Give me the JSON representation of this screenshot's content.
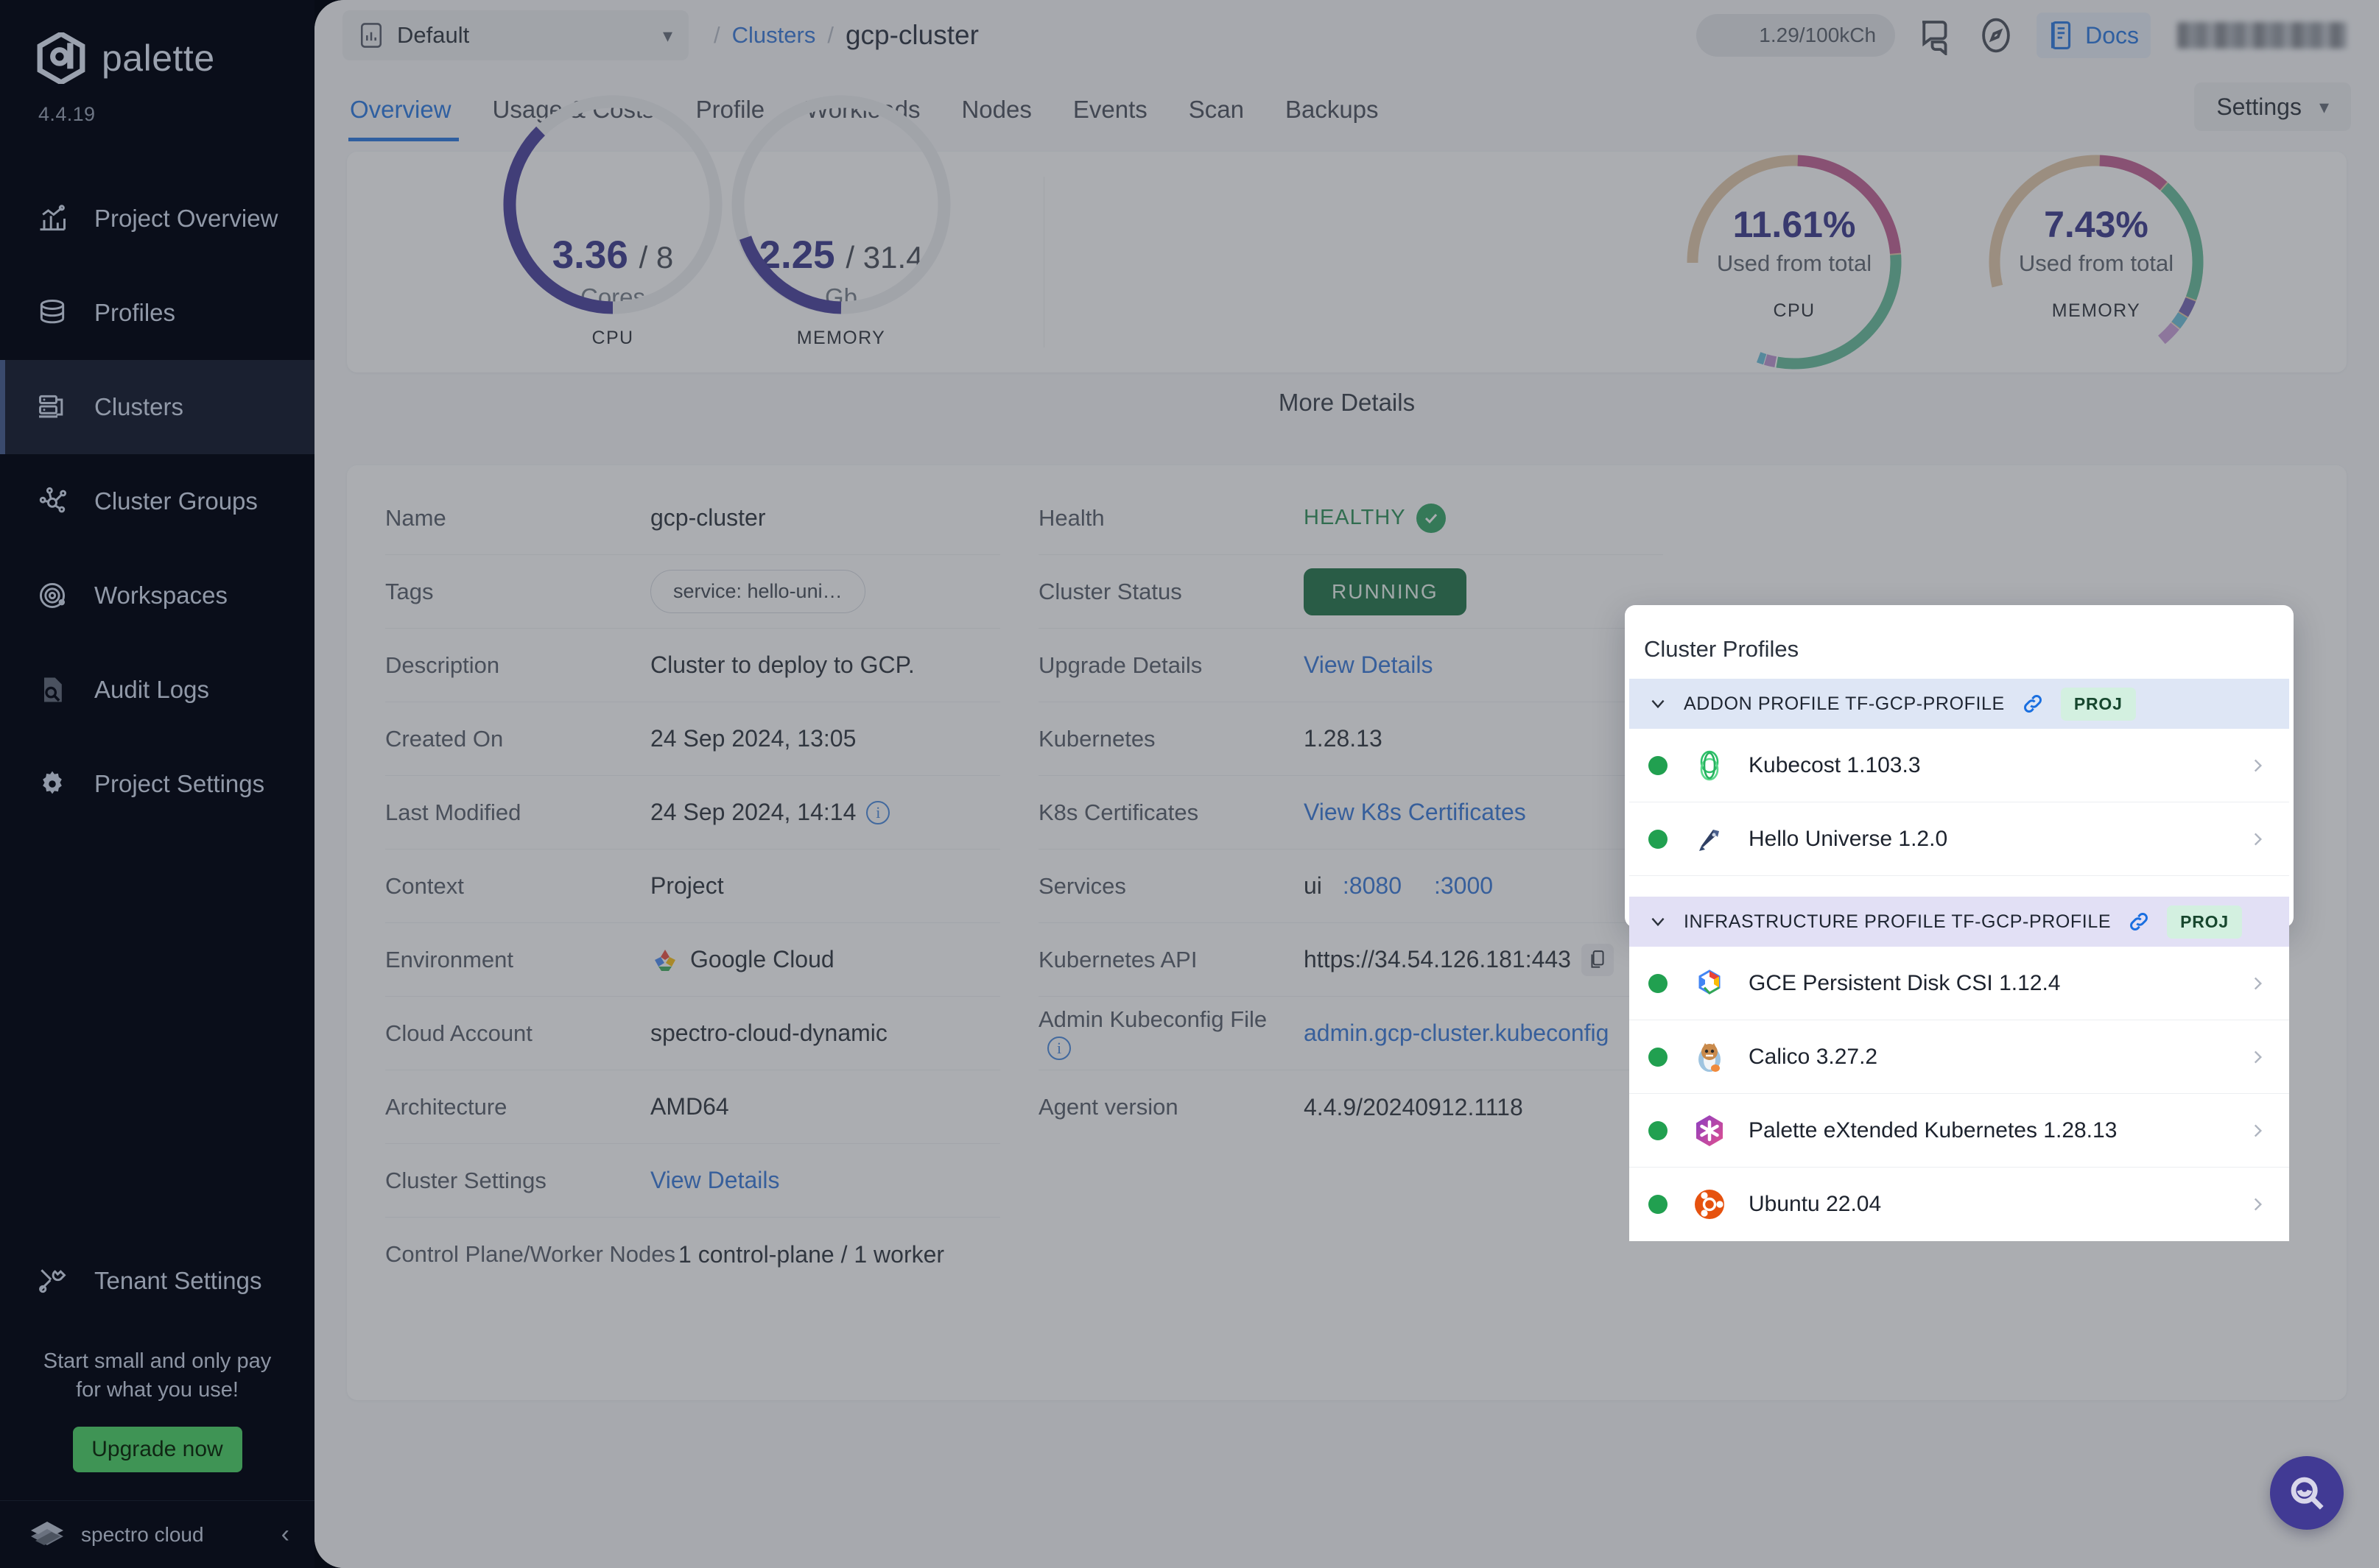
{
  "sidebar": {
    "brand": "palette",
    "version": "4.4.19",
    "items": [
      {
        "label": "Project Overview",
        "icon": "chart-bars-icon"
      },
      {
        "label": "Profiles",
        "icon": "layers-icon"
      },
      {
        "label": "Clusters",
        "icon": "servers-icon"
      },
      {
        "label": "Cluster Groups",
        "icon": "nodes-icon"
      },
      {
        "label": "Workspaces",
        "icon": "orbit-icon"
      },
      {
        "label": "Audit Logs",
        "icon": "document-search-icon"
      },
      {
        "label": "Project Settings",
        "icon": "gear-icon"
      }
    ],
    "tenant_settings": "Tenant Settings",
    "promo_line1": "Start small and only pay",
    "promo_line2": "for what you use!",
    "upgrade_label": "Upgrade now",
    "footer_brand": "spectro cloud"
  },
  "topbar": {
    "project": "Default",
    "breadcrumb_parent": "Clusters",
    "breadcrumb_current": "gcp-cluster",
    "usage_chip": "1.29/100kCh",
    "docs_label": "Docs"
  },
  "tabs": [
    {
      "label": "Overview",
      "active": true
    },
    {
      "label": "Usage & Costs",
      "active": false
    },
    {
      "label": "Profile",
      "active": false
    },
    {
      "label": "Workloads",
      "active": false
    },
    {
      "label": "Nodes",
      "active": false
    },
    {
      "label": "Events",
      "active": false
    },
    {
      "label": "Scan",
      "active": false
    },
    {
      "label": "Backups",
      "active": false
    }
  ],
  "settings_button": "Settings",
  "metrics": {
    "gauges": [
      {
        "value": "3.36",
        "total": "/ 8",
        "unit": "Cores",
        "caption": "CPU",
        "pct": 42
      },
      {
        "value": "2.25",
        "total": "/ 31.4",
        "unit": "Gb",
        "caption": "MEMORY",
        "pct": 7.2
      }
    ],
    "donuts": [
      {
        "pct": "11.61%",
        "sub": "Used from total",
        "caption": "CPU"
      },
      {
        "pct": "7.43%",
        "sub": "Used from total",
        "caption": "MEMORY"
      }
    ],
    "more_details": "More Details"
  },
  "details_left": [
    {
      "label": "Name",
      "value": "gcp-cluster",
      "kind": "text"
    },
    {
      "label": "Tags",
      "value": "service: hello-uni…",
      "kind": "tag"
    },
    {
      "label": "Description",
      "value": "Cluster to deploy to GCP.",
      "kind": "text"
    },
    {
      "label": "Created On",
      "value": "24 Sep 2024, 13:05",
      "kind": "text"
    },
    {
      "label": "Last Modified",
      "value": "24 Sep 2024, 14:14",
      "kind": "text-info"
    },
    {
      "label": "Context",
      "value": "Project",
      "kind": "text"
    },
    {
      "label": "Environment",
      "value": "Google Cloud",
      "kind": "env"
    },
    {
      "label": "Cloud Account",
      "value": "spectro-cloud-dynamic",
      "kind": "text"
    },
    {
      "label": "Architecture",
      "value": "AMD64",
      "kind": "text"
    },
    {
      "label": "Cluster Settings",
      "value": "View Details",
      "kind": "link"
    },
    {
      "label": "Control Plane/Worker Nodes",
      "value": "1 control-plane / 1 worker",
      "kind": "text"
    }
  ],
  "details_right": [
    {
      "label": "Health",
      "value": "HEALTHY",
      "kind": "health"
    },
    {
      "label": "Cluster Status",
      "value": "RUNNING",
      "kind": "pill"
    },
    {
      "label": "Upgrade Details",
      "value": "View Details",
      "kind": "link"
    },
    {
      "label": "Kubernetes",
      "value": "1.28.13",
      "kind": "text"
    },
    {
      "label": "K8s Certificates",
      "value": "View K8s Certificates",
      "kind": "link"
    },
    {
      "label": "Services",
      "value": "ui",
      "ports": [
        ":8080",
        ":3000"
      ],
      "kind": "services"
    },
    {
      "label": "Kubernetes API",
      "value": "https://34.54.126.181:443",
      "kind": "copy"
    },
    {
      "label": "Admin Kubeconfig File",
      "value": "admin.gcp-cluster.kubeconfig",
      "kind": "link-info"
    },
    {
      "label": "Agent version",
      "value": "4.4.9/20240912.1118",
      "kind": "text"
    }
  ],
  "popup": {
    "title": "Cluster Profiles",
    "groups": [
      {
        "label": "ADDON PROFILE TF-GCP-PROFILE",
        "badge": "PROJ",
        "type": "addon",
        "packs": [
          {
            "name": "Kubecost 1.103.3",
            "status": "green",
            "icon": "kubecost-icon"
          },
          {
            "name": "Hello Universe 1.2.0",
            "status": "green",
            "icon": "hello-universe-icon"
          }
        ]
      },
      {
        "label": "INFRASTRUCTURE PROFILE TF-GCP-PROFILE",
        "badge": "PROJ",
        "type": "infra",
        "packs": [
          {
            "name": "GCE Persistent Disk CSI 1.12.4",
            "status": "green",
            "icon": "gcp-icon"
          },
          {
            "name": "Calico 3.27.2",
            "status": "green",
            "icon": "calico-icon"
          },
          {
            "name": "Palette eXtended Kubernetes 1.28.13",
            "status": "green",
            "icon": "palette-k8s-icon"
          },
          {
            "name": "Ubuntu 22.04",
            "status": "green",
            "icon": "ubuntu-icon"
          }
        ]
      }
    ]
  },
  "colors": {
    "accent_blue": "#1a6fe0",
    "brand_purple": "#2c2a84",
    "status_green": "#10693a",
    "healthy_green": "#1f8a4c",
    "upgrade_green": "#3f9455",
    "sidebar_bg": "#0a0e1a",
    "addon_group_bg": "#dee6f5",
    "infra_group_bg": "#e2e0f5",
    "badge_bg": "#d3f0e0"
  }
}
